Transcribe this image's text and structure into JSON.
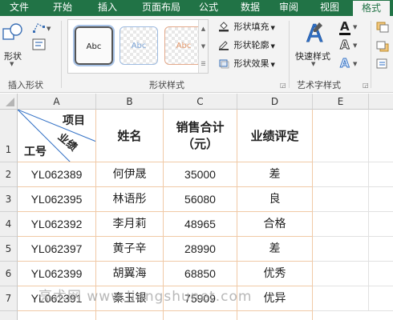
{
  "ribbon": {
    "tabs": [
      {
        "label": "文件",
        "active": false
      },
      {
        "label": "开始",
        "active": false
      },
      {
        "label": "插入",
        "active": false
      },
      {
        "label": "页面布局",
        "active": false
      },
      {
        "label": "公式",
        "active": false
      },
      {
        "label": "数据",
        "active": false
      },
      {
        "label": "审阅",
        "active": false
      },
      {
        "label": "视图",
        "active": false
      },
      {
        "label": "格式",
        "active": true
      }
    ],
    "groups": {
      "insert_shapes": {
        "label": "插入形状",
        "shape_button": "形状"
      },
      "shape_styles": {
        "label": "形状样式",
        "samples": [
          "Abc",
          "Abc",
          "Abc"
        ],
        "fill": "形状填充",
        "outline": "形状轮廓",
        "effects": "形状效果"
      },
      "wordart_styles": {
        "label": "艺术字样式",
        "quick_styles": "快速样式"
      }
    }
  },
  "sheet": {
    "columns": [
      "A",
      "B",
      "C",
      "D",
      "E"
    ],
    "rows": [
      "1",
      "2",
      "3",
      "4",
      "5",
      "6",
      "7"
    ],
    "header": {
      "diag_top": "项目",
      "diag_mid": "业绩",
      "diag_bottom": "工号",
      "name": "姓名",
      "sales": "销售合计（元）",
      "rating": "业绩评定"
    },
    "records": [
      {
        "id": "YL062389",
        "name": "何伊晟",
        "sales": "35000",
        "rating": "差"
      },
      {
        "id": "YL062395",
        "name": "林语彤",
        "sales": "56080",
        "rating": "良"
      },
      {
        "id": "YL062392",
        "name": "李月莉",
        "sales": "48965",
        "rating": "合格"
      },
      {
        "id": "YL062397",
        "name": "黄子辛",
        "sales": "28990",
        "rating": "差"
      },
      {
        "id": "YL062399",
        "name": "胡翼海",
        "sales": "68850",
        "rating": "优秀"
      },
      {
        "id": "YL062391",
        "name": "秦玉银",
        "sales": "75909",
        "rating": "优异"
      }
    ]
  },
  "watermark": "亮术网 www.liangshunet.com",
  "colors": {
    "ribbon_green": "#217346",
    "table_border": "#f0c9a6",
    "wordart_blue": "#2e6ec4"
  }
}
